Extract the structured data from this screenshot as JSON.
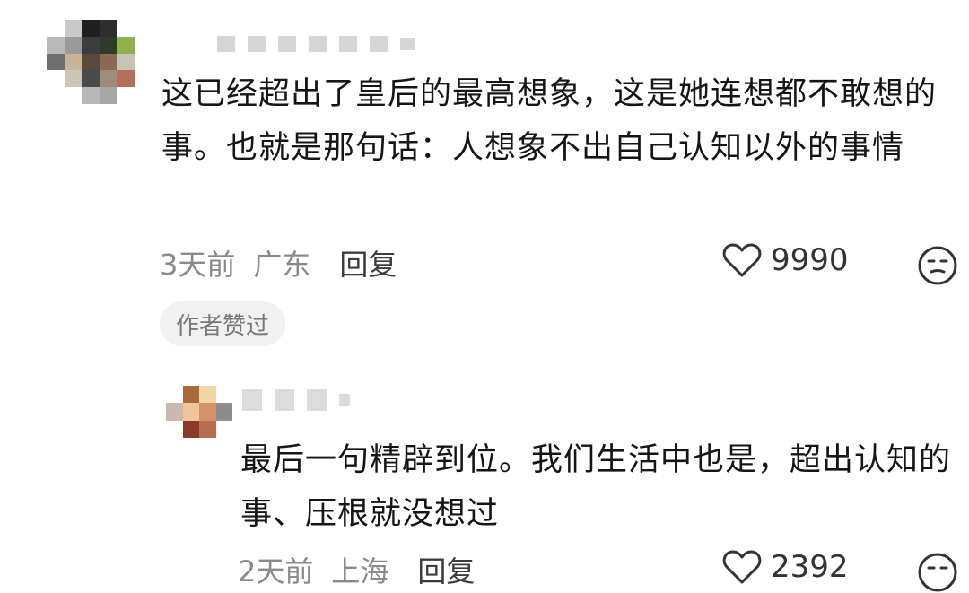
{
  "main_comment": {
    "text": "这已经超出了皇后的最高想象，这是她连想都不敢想的事。也就是那句话：人想象不出自己认知以外的事情",
    "time": "3天前",
    "location": "广东",
    "reply_label": "回复",
    "likes": "9990",
    "badge": "作者赞过"
  },
  "reply_comment": {
    "text": "最后一句精辟到位。我们生活中也是，超出认知的事、压根就没想过",
    "time": "2天前",
    "location": "上海",
    "reply_label": "回复",
    "likes": "2392"
  },
  "icons": {
    "like": "heart-outline-icon",
    "react": "neutral-face-icon"
  },
  "colors": {
    "text": "#151515",
    "meta": "#8a8a8a",
    "badge_bg": "#f1f1f1",
    "badge_text": "#777777"
  }
}
